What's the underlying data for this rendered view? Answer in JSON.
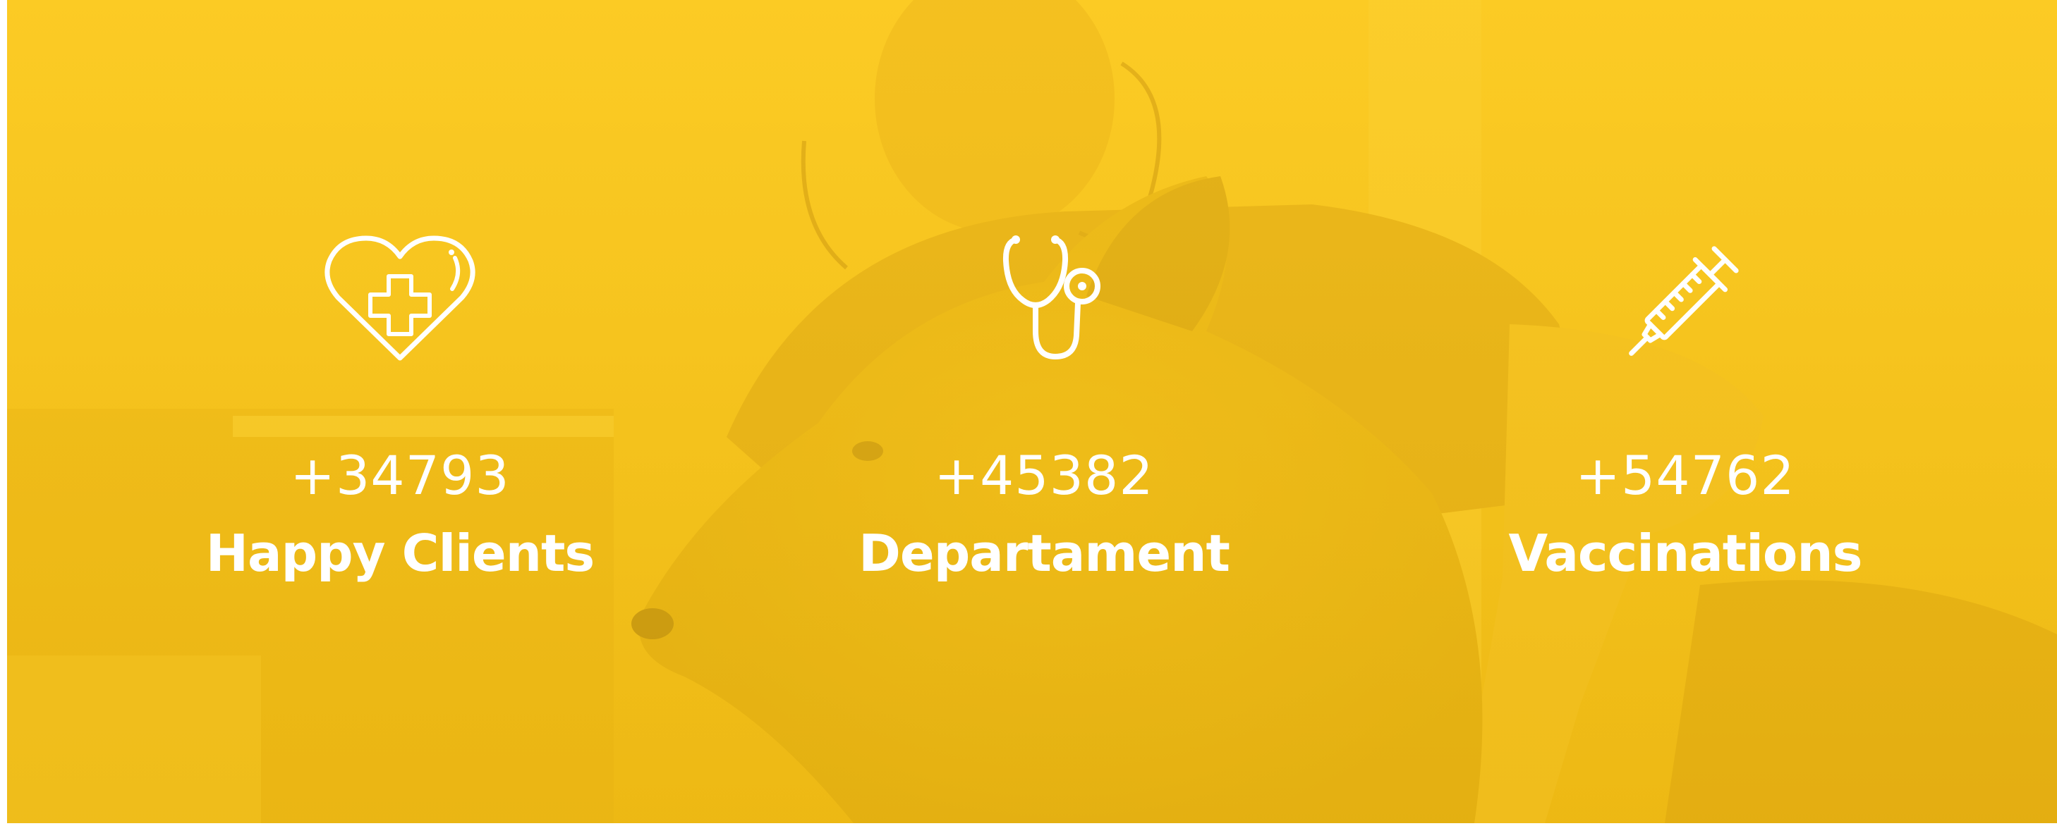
{
  "colors": {
    "accent": "#F5C518",
    "text": "#FFFFFF"
  },
  "stats": [
    {
      "count": "+34793",
      "label": "Happy Clients",
      "icon": "heart-medical-cross-icon"
    },
    {
      "count": "+45382",
      "label": "Departament",
      "icon": "stethoscope-icon"
    },
    {
      "count": "+54762",
      "label": "Vaccinations",
      "icon": "syringe-icon"
    }
  ]
}
